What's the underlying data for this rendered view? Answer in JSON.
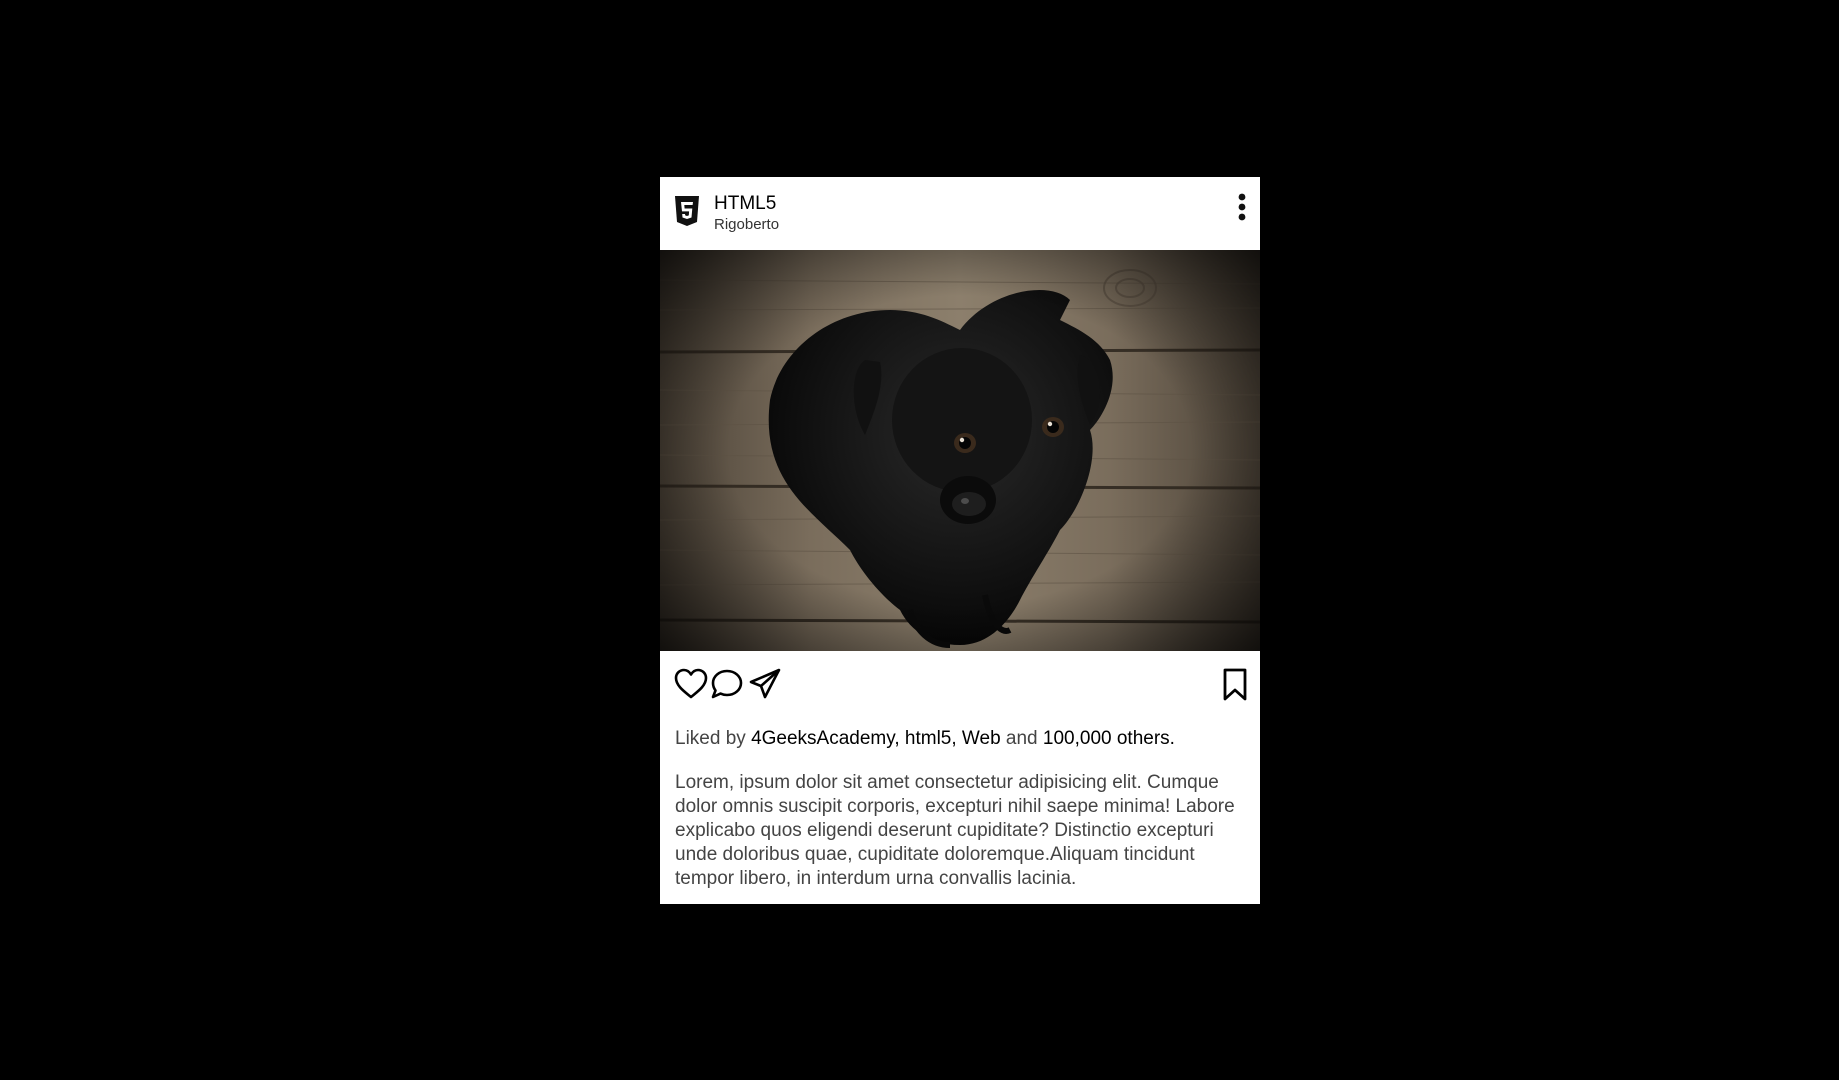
{
  "post": {
    "brand": "HTML5",
    "user": "Rigoberto",
    "photo_alt": "black puppy",
    "likes": {
      "prefix": "Liked by",
      "names": "4GeeksAcademy, html5, Web",
      "and": "and",
      "count": "100,000 others."
    },
    "caption": "Lorem, ipsum dolor sit amet consectetur adipisicing elit. Cumque dolor omnis suscipit corporis, excepturi nihil saepe minima! Labore explicabo quos eligendi deserunt cupiditate? Distinctio excepturi unde doloribus quae, cupiditate doloremque.Aliquam tincidunt tempor libero, in interdum urna convallis lacinia."
  },
  "icons": {
    "logo": "html5-icon",
    "more": "more-vertical-icon",
    "like": "heart-icon",
    "comment": "comment-icon",
    "share": "send-icon",
    "save": "bookmark-icon"
  },
  "colors": {
    "page_background": "#000000",
    "card_background": "#ffffff",
    "text_primary": "#000000",
    "text_secondary": "#444444"
  }
}
